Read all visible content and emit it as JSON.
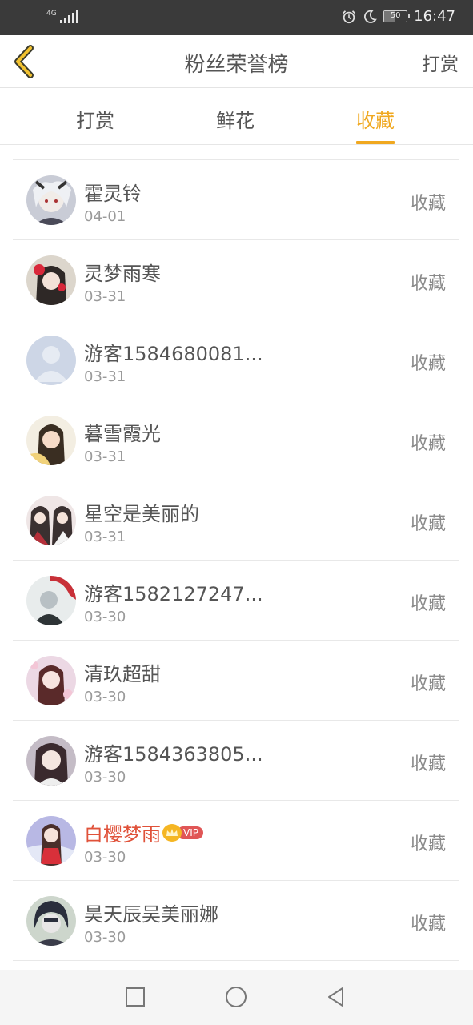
{
  "status_bar": {
    "network": "4G",
    "battery": "50",
    "battery_level": 0.5,
    "time": "16:47",
    "icons": [
      "alarm-icon",
      "moon-icon"
    ]
  },
  "header": {
    "back_icon": "chevron-left-icon",
    "title": "粉丝荣誉榜",
    "action": "打赏"
  },
  "tabs": [
    {
      "label": "打赏",
      "active": false
    },
    {
      "label": "鲜花",
      "active": false
    },
    {
      "label": "收藏",
      "active": true
    }
  ],
  "colors": {
    "accent": "#f0a820",
    "vip_name": "#e0523a",
    "vip_badge": "#e05656",
    "crown": "#f5b623"
  },
  "fans": [
    {
      "name": "霍灵铃",
      "date": "04-01",
      "action": "收藏"
    },
    {
      "name": "灵梦雨寒",
      "date": "03-31",
      "action": "收藏"
    },
    {
      "name": "游客1584680081...",
      "date": "03-31",
      "action": "收藏"
    },
    {
      "name": "暮雪霞光",
      "date": "03-31",
      "action": "收藏"
    },
    {
      "name": "星空是美丽的",
      "date": "03-31",
      "action": "收藏"
    },
    {
      "name": "游客1582127247...",
      "date": "03-30",
      "action": "收藏"
    },
    {
      "name": "清玖超甜",
      "date": "03-30",
      "action": "收藏"
    },
    {
      "name": "游客1584363805...",
      "date": "03-30",
      "action": "收藏"
    },
    {
      "name": "白樱梦雨",
      "date": "03-30",
      "action": "收藏",
      "vip": "VIP"
    },
    {
      "name": "昊天辰吴美丽娜",
      "date": "03-30",
      "action": "收藏"
    }
  ],
  "nav_bar": [
    "square-icon",
    "circle-icon",
    "triangle-back-icon"
  ]
}
